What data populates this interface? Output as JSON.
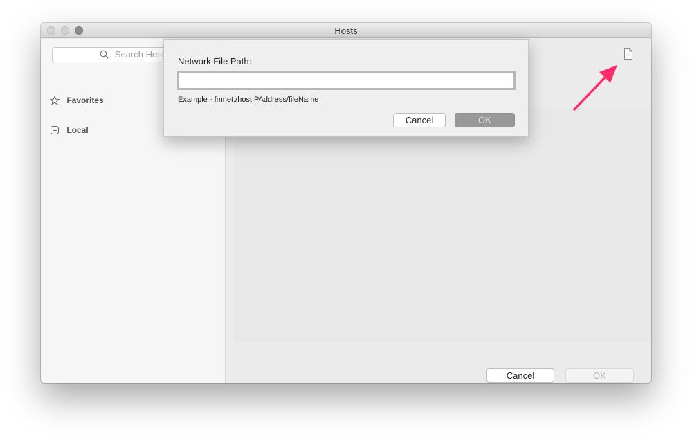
{
  "window": {
    "title": "Hosts"
  },
  "sidebar": {
    "search_placeholder": "Search Hosts",
    "items": [
      {
        "label": "Favorites",
        "icon": "star-icon"
      },
      {
        "label": "Local",
        "icon": "local-list-icon"
      }
    ]
  },
  "main": {
    "cancel_label": "Cancel",
    "ok_label": "OK",
    "toolbar_icon": "document-ellipsis-icon"
  },
  "sheet": {
    "label": "Network File Path:",
    "input_value": "",
    "example": "Example - fmnet:/hostIPAddress/fileName",
    "cancel_label": "Cancel",
    "ok_label": "OK"
  },
  "annotation": {
    "arrow_color": "#ff2d6a"
  }
}
